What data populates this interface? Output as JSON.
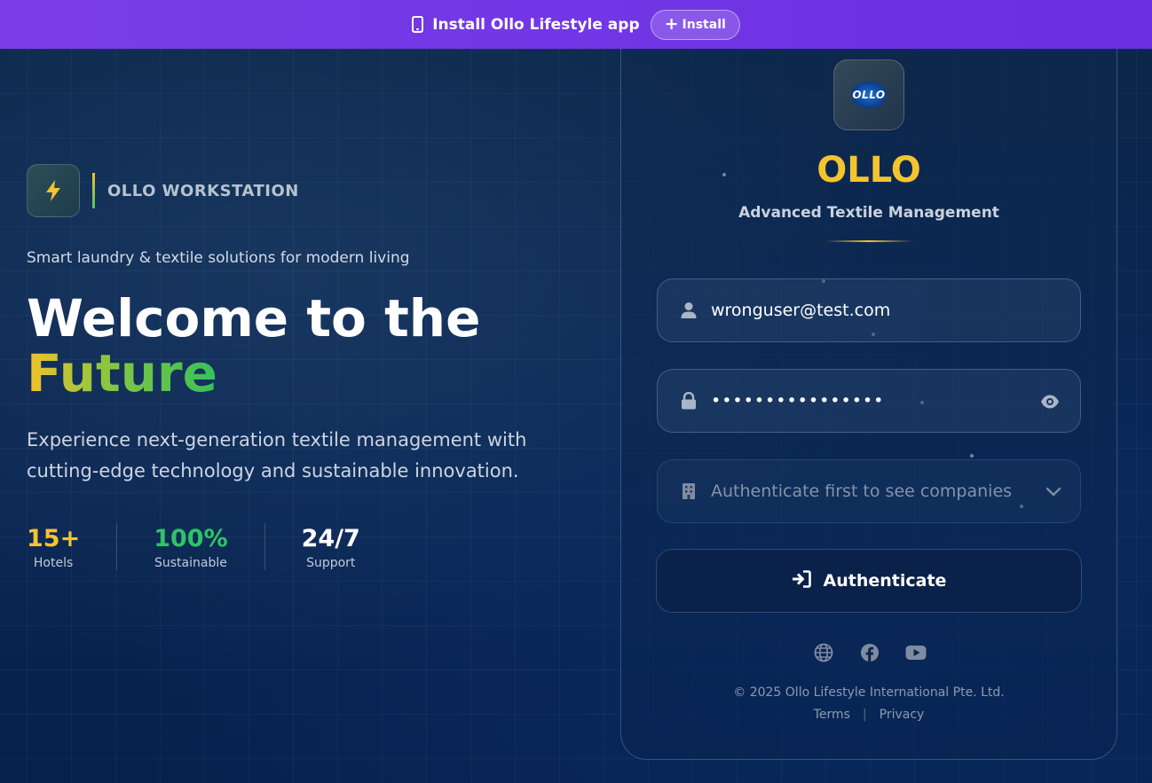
{
  "banner": {
    "text": "Install Ollo Lifestyle app",
    "install_label": "Install"
  },
  "hero": {
    "brand_name": "OLLO WORKSTATION",
    "tagline": "Smart laundry & textile solutions for modern living",
    "headline_line1": "Welcome to the",
    "headline_line2": "Future",
    "description": "Experience next-generation textile management with cutting-edge technology and sustainable innovation.",
    "stats": [
      {
        "value": "15+",
        "label": "Hotels",
        "color": "#f4c430"
      },
      {
        "value": "100%",
        "label": "Sustainable",
        "color": "#2ec464"
      },
      {
        "value": "24/7",
        "label": "Support",
        "color": "#ffffff"
      }
    ]
  },
  "login": {
    "logo_text": "OLLO",
    "title": "OLLO",
    "subtitle": "Advanced Textile Management",
    "email_value": "wronguser@test.com",
    "password_value": "••••••••••••••••",
    "company_placeholder": "Authenticate first to see companies",
    "submit_label": "Authenticate",
    "socials": [
      "globe-icon",
      "facebook-icon",
      "youtube-icon"
    ],
    "copyright": "© 2025 Ollo Lifestyle International Pte. Ltd.",
    "terms_label": "Terms",
    "privacy_label": "Privacy",
    "link_separator": "|"
  },
  "colors": {
    "banner": "#7236e6",
    "accent_yellow": "#f4c430",
    "accent_green": "#2ec464",
    "background": "#0b2447"
  }
}
